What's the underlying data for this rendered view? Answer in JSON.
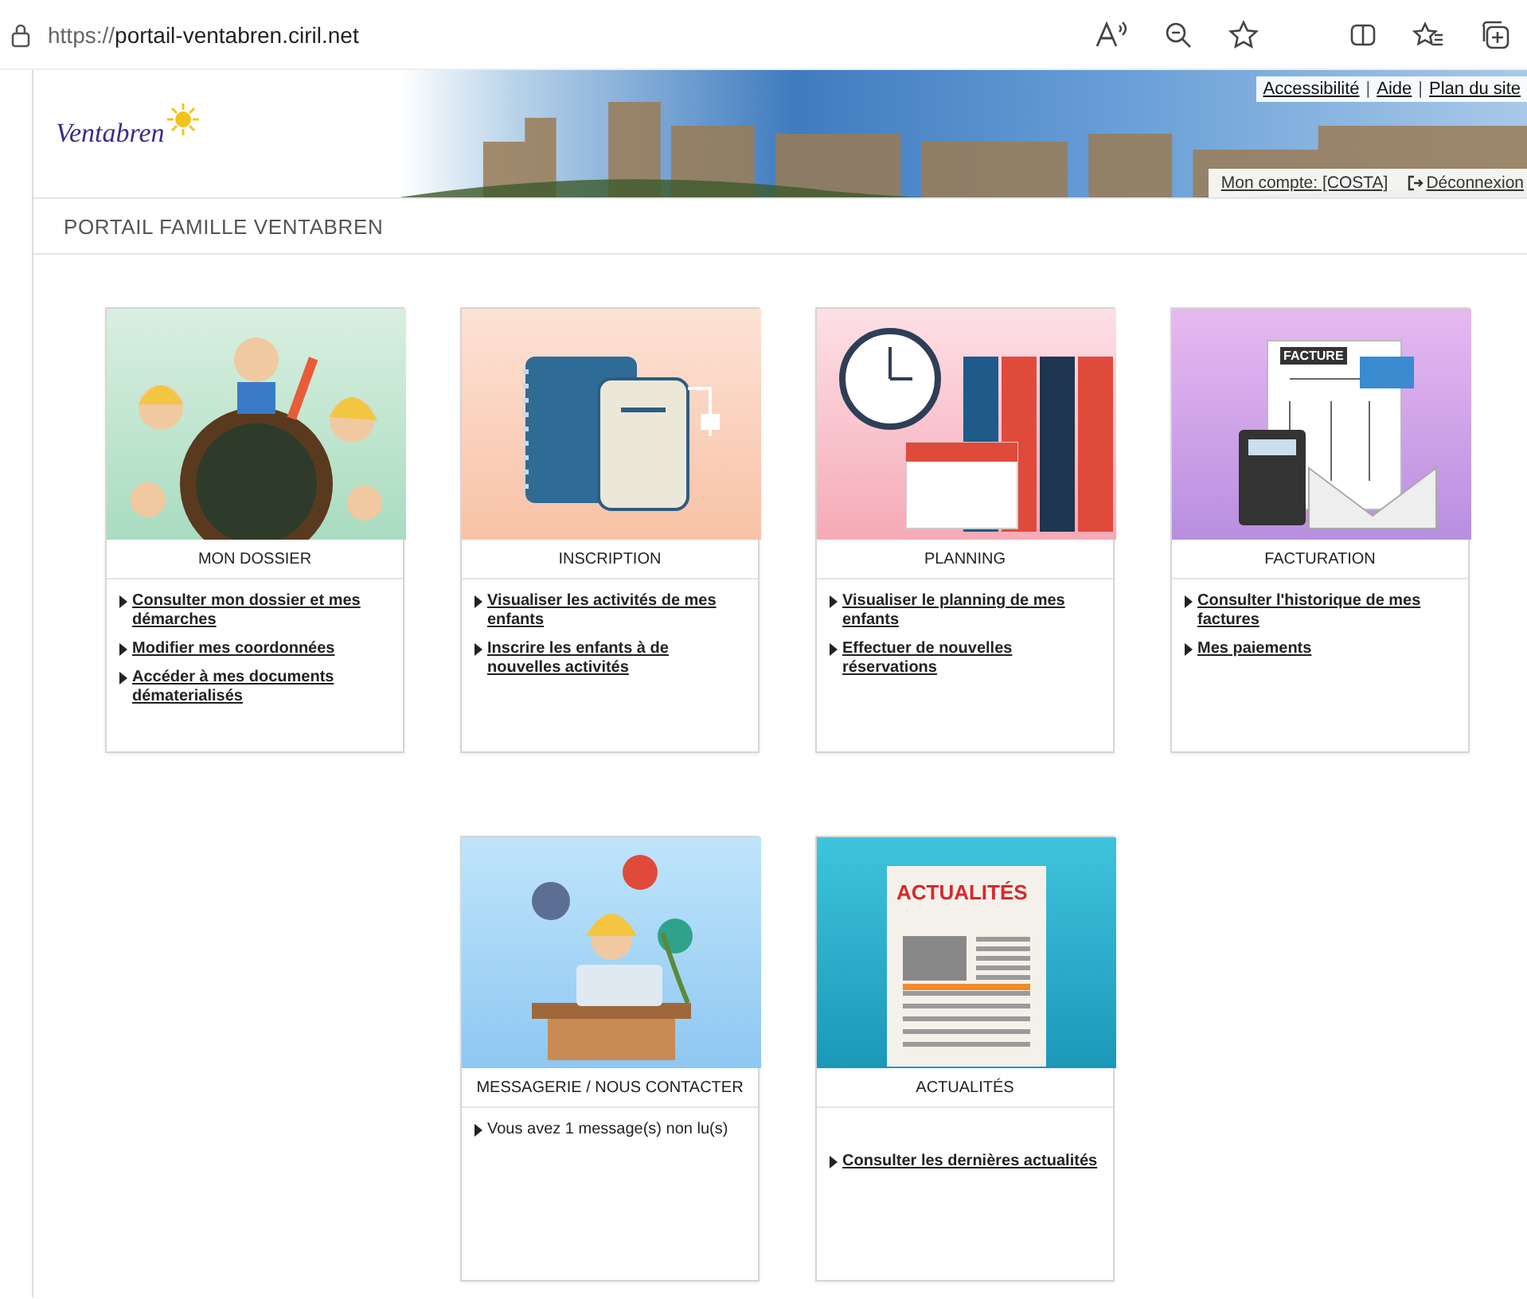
{
  "browser": {
    "url_scheme": "https://",
    "url_host": "portail-ventabren.ciril.net"
  },
  "header": {
    "logo_text": "Ventabren",
    "top_links": [
      "Accessibilité",
      "Aide",
      "Plan du site"
    ],
    "link_separator": "|",
    "account_link": "Mon compte: [COSTA]",
    "logout_link": "Déconnexion"
  },
  "page_title": "PORTAIL FAMILLE VENTABREN",
  "cards": [
    {
      "kind": "dossier",
      "title": "MON DOSSIER",
      "items": [
        {
          "kind": "link",
          "text": "Consulter mon dossier et mes démarches"
        },
        {
          "kind": "link",
          "text": "Modifier mes coordonnées"
        },
        {
          "kind": "link",
          "text": "Accéder à mes documents dématerialisés"
        }
      ]
    },
    {
      "kind": "inscription",
      "title": "INSCRIPTION",
      "items": [
        {
          "kind": "link",
          "text": "Visualiser les activités de mes enfants"
        },
        {
          "kind": "link",
          "text": "Inscrire les enfants à de nouvelles activités"
        }
      ]
    },
    {
      "kind": "planning",
      "title": "PLANNING",
      "items": [
        {
          "kind": "link",
          "text": "Visualiser le planning de mes enfants"
        },
        {
          "kind": "link",
          "text": "Effectuer de nouvelles réservations"
        }
      ]
    },
    {
      "kind": "facturation",
      "title": "FACTURATION",
      "items": [
        {
          "kind": "link",
          "text": "Consulter l'historique de mes factures"
        },
        {
          "kind": "link",
          "text": "Mes paiements"
        }
      ],
      "image_label": "FACTURE"
    },
    {
      "kind": "messagerie",
      "title": "MESSAGERIE / NOUS CONTACTER",
      "items": [
        {
          "kind": "text",
          "text": "Vous avez 1 message(s) non lu(s)"
        }
      ]
    },
    {
      "kind": "actualites",
      "title": "ACTUALITÉS",
      "items": [
        {
          "kind": "link",
          "text": "Consulter les dernières actualités"
        }
      ],
      "image_label": "ACTUALITÉS"
    }
  ]
}
